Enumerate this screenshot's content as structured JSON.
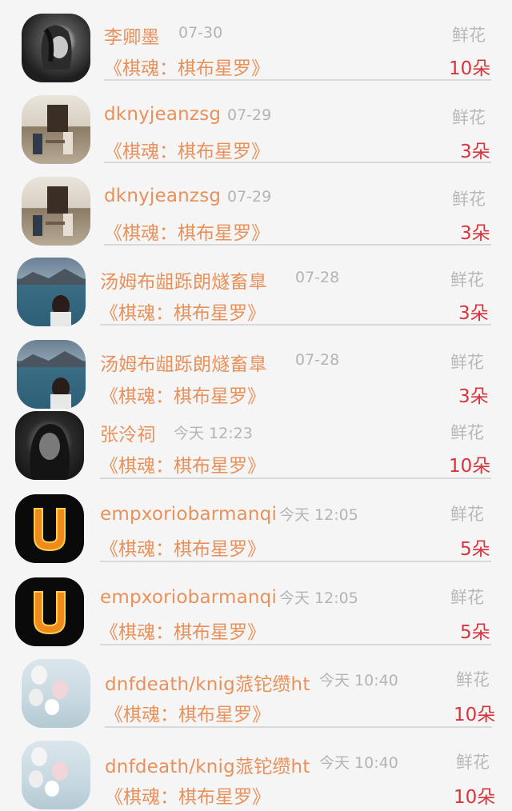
{
  "gift_label": "鲜花",
  "rows": [
    {
      "name": "李卿墨",
      "time": "07-30",
      "book": "《棋魂：棋布星罗》",
      "count": "10朵",
      "avatar": "girl-dark-icon"
    },
    {
      "name": "dknyjeanzsg",
      "time": "07-29",
      "book": "《棋魂：棋布星罗》",
      "count": "3朵",
      "avatar": "cafe-photo-icon"
    },
    {
      "name": "dknyjeanzsg",
      "time": "07-29",
      "book": "《棋魂：棋布星罗》",
      "count": "3朵",
      "avatar": "cafe-photo-icon"
    },
    {
      "name": "汤姆布龃跞朗燧畜臯",
      "time": "07-28",
      "book": "《棋魂：棋布星罗》",
      "count": "3朵",
      "avatar": "lake-girl-icon"
    },
    {
      "name": "汤姆布龃跞朗燧畜臯",
      "time": "07-28",
      "book": "《棋魂：棋布星罗》",
      "count": "3朵",
      "avatar": "lake-girl-icon"
    },
    {
      "name": "张泠祠",
      "time": "今天 12:23",
      "book": "《棋魂：棋布星罗》",
      "count": "10朵",
      "avatar": "portrait-dark-icon"
    },
    {
      "name": "empxoriobarmanqi",
      "time": "今天 12:05",
      "book": "《棋魂：棋布星罗》",
      "count": "5朵",
      "avatar": "fire-letter-u-icon"
    },
    {
      "name": "empxoriobarmanqi",
      "time": "今天 12:05",
      "book": "《棋魂：棋布星罗》",
      "count": "5朵",
      "avatar": "fire-letter-u-icon"
    },
    {
      "name": "dnfdeath/knig蒎铊缵ht",
      "time": "今天 10:40",
      "book": "《棋魂：棋布星罗》",
      "count": "10朵",
      "avatar": "balloons-icon"
    },
    {
      "name": "dnfdeath/knig蒎铊缵ht",
      "time": "今天 10:40",
      "book": "《棋魂：棋布星罗》",
      "count": "10朵",
      "avatar": "balloons-icon"
    }
  ],
  "colors": {
    "name": "#e8915b",
    "book": "#e8915b",
    "count": "#d9343b",
    "muted": "#b4b4b4",
    "divider": "#d9d9d9"
  }
}
